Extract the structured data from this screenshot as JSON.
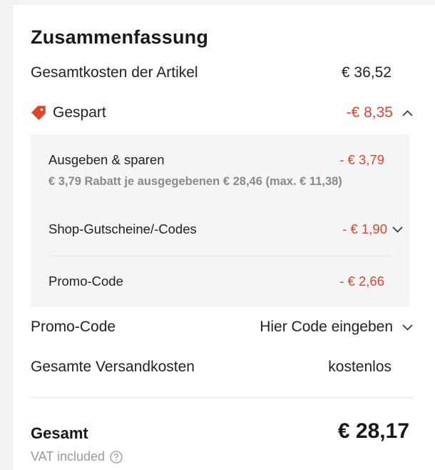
{
  "summary": {
    "title": "Zusammenfassung",
    "items_total_label": "Gesamtkosten der Artikel",
    "items_total_value": "€ 36,52",
    "saved_label": "Gespart",
    "saved_value": "-€ 8,35",
    "saved_icon": "tag-icon",
    "saved_toggle_icon": "chevron-up-icon"
  },
  "discounts": {
    "spend_save_label": "Ausgeben & sparen",
    "spend_save_value": "- € 3,79",
    "spend_save_detail": "€ 3,79 Rabatt je ausgegebenen € 28,46 (max. € 11,38)",
    "shop_coupons_label": "Shop-Gutscheine/-Codes",
    "shop_coupons_value": "- € 1,90",
    "shop_coupons_icon": "chevron-down-icon",
    "promo_label": "Promo-Code",
    "promo_value": "- € 2,66"
  },
  "promo_code": {
    "label": "Promo-Code",
    "action": "Hier Code eingeben",
    "icon": "chevron-down-icon"
  },
  "shipping": {
    "label": "Gesamte Versandkosten",
    "value": "kostenlos"
  },
  "total": {
    "label": "Gesamt",
    "value": "€ 28,17",
    "vat_note": "VAT included",
    "info_icon": "question-circle-icon"
  },
  "colors": {
    "accent_red": "#e0452a",
    "panel_bg": "#f5f5f5",
    "muted_text": "#8a8a8a"
  }
}
